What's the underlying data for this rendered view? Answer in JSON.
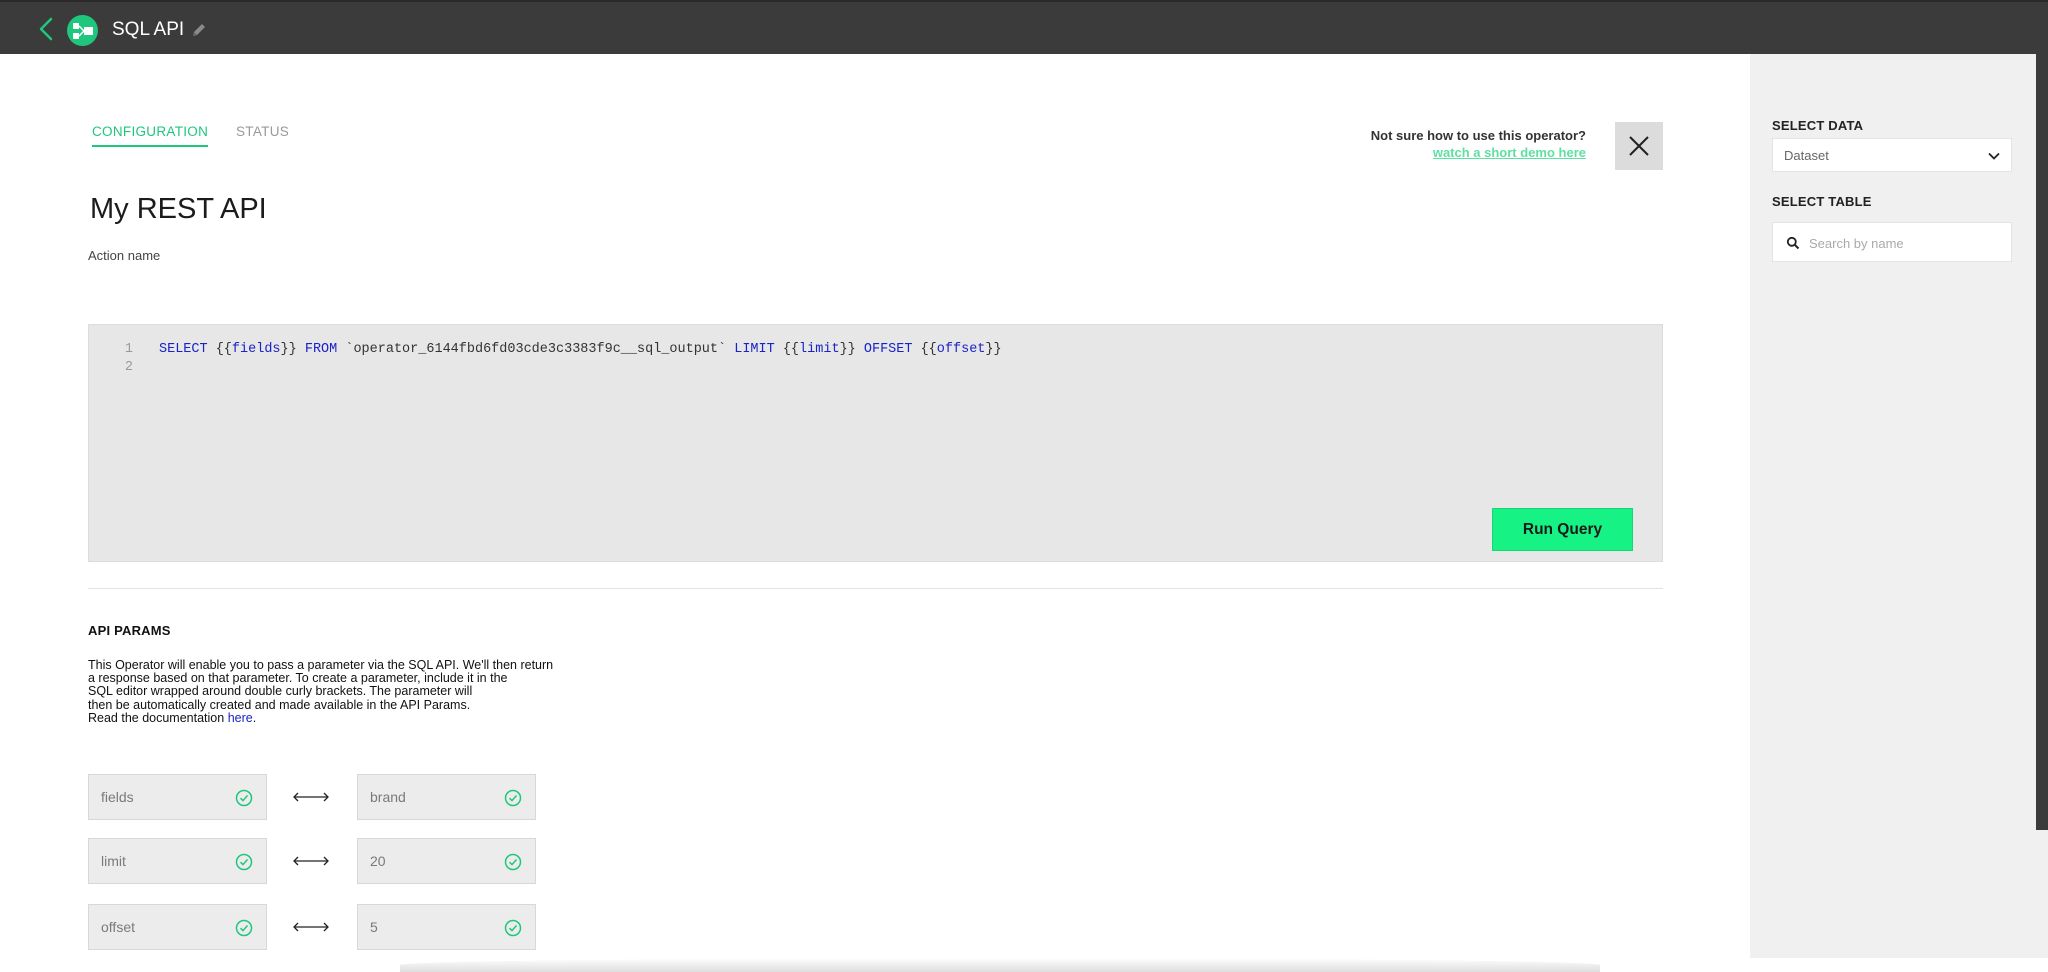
{
  "header": {
    "title": "SQL API"
  },
  "tabs": [
    {
      "label": "CONFIGURATION",
      "active": true
    },
    {
      "label": "STATUS",
      "active": false
    }
  ],
  "help": {
    "question": "Not sure how to use this operator?",
    "link_text": "watch a short demo here"
  },
  "main": {
    "title": "My REST API",
    "action_label": "Action name"
  },
  "editor": {
    "line_numbers": [
      "1",
      "2"
    ],
    "tokens": {
      "select": "SELECT",
      "open1": " {{",
      "fields": "fields",
      "close1": "}} ",
      "from": "FROM",
      "table": " `operator_6144fbd6fd03cde3c3383f9c__sql_output` ",
      "limit_kw": "LIMIT",
      "open2": " {{",
      "limit_var": "limit",
      "close2": "}} ",
      "offset_kw": "OFFSET",
      "open3": " {{",
      "offset_var": "offset",
      "close3": "}}"
    },
    "run_label": "Run Query"
  },
  "api_params": {
    "heading": "API PARAMS",
    "description_lines": [
      "This Operator will enable you to pass a parameter via the SQL API. We'll then return",
      "a response based on that parameter. To create a parameter, include it in the",
      "SQL editor wrapped around double curly brackets. The parameter will",
      "then be automatically created and made available in the API Params."
    ],
    "doc_prefix": "Read the documentation ",
    "doc_link": "here",
    "doc_suffix": ".",
    "params": [
      {
        "name": "fields",
        "value": "brand"
      },
      {
        "name": "limit",
        "value": "20"
      },
      {
        "name": "offset",
        "value": "5"
      }
    ]
  },
  "sidebar": {
    "select_data_label": "SELECT DATA",
    "select_data_value": "Dataset",
    "select_table_label": "SELECT TABLE",
    "search_placeholder": "Search by name"
  },
  "colors": {
    "accent": "#1ec77c",
    "run_button": "#17f285",
    "topbar": "#3b3b3b",
    "keyword": "#1a22c9"
  }
}
